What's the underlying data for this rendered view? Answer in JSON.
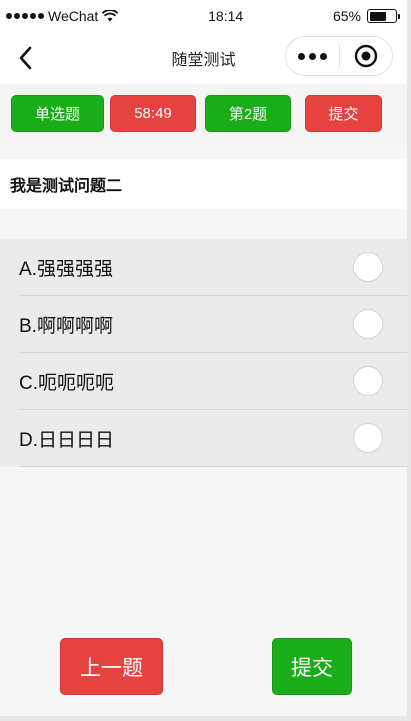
{
  "status_bar": {
    "carrier": "WeChat",
    "time": "18:14",
    "battery": "65%",
    "battery_level": 0.65
  },
  "navbar": {
    "title": "随堂测试"
  },
  "toolbar": {
    "type_label": "单选题",
    "timer": "58:49",
    "question_number": "第2题",
    "submit_label": "提交"
  },
  "question": {
    "text": "我是测试问题二"
  },
  "options": [
    {
      "text": "A.强强强强"
    },
    {
      "text": "B.啊啊啊啊"
    },
    {
      "text": "C.呃呃呃呃"
    },
    {
      "text": "D.日日日日"
    }
  ],
  "footer": {
    "prev_label": "上一题",
    "submit_label": "提交"
  },
  "colors": {
    "green": "#1aad19",
    "red": "#e64340"
  }
}
